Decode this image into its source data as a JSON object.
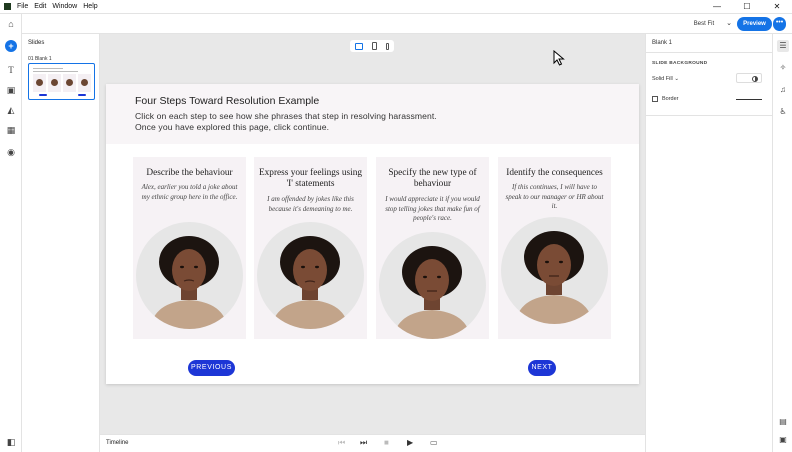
{
  "menu": {
    "items": [
      "File",
      "Edit",
      "Window",
      "Help"
    ]
  },
  "window_controls": [
    "—",
    "☐",
    "✕"
  ],
  "toolbar": {
    "zoom": "Best Fit",
    "preview_label": "Preview",
    "more_label": "•••"
  },
  "slides_panel": {
    "title": "Slides",
    "slide_name": "01  Blank 1"
  },
  "right_panel": {
    "title": "Blank 1",
    "section": "SLIDE BACKGROUND",
    "fill": "Solid Fill",
    "border_label": "Border"
  },
  "timeline": {
    "label": "Timeline"
  },
  "slide": {
    "title": "Four Steps Toward Resolution Example",
    "subtitle_line1": "Click on each step to see how she phrases that step in resolving harassment.",
    "subtitle_line2": "Once you have explored this page, click continue.",
    "cards": [
      {
        "heading": "Describe the behaviour",
        "quote": "Alex, earlier you told a joke about my ethnic group here in the office."
      },
      {
        "heading": "Express your feelings using 'I' statements",
        "quote": "I am offended by jokes like this because it's demeaning to me."
      },
      {
        "heading": "Specify the new type of behaviour",
        "quote": "I would appreciate it if you would stop telling jokes that make fun of people's race."
      },
      {
        "heading": "Identify the consequences",
        "quote": "If this continues, I will have to speak to our manager or HR about it."
      }
    ],
    "previous_label": "PREVIOUS",
    "next_label": "NEXT"
  },
  "colors": {
    "accent": "#1473e6",
    "nav_button": "#1d36d6",
    "card_bg": "#f6f2f5"
  }
}
